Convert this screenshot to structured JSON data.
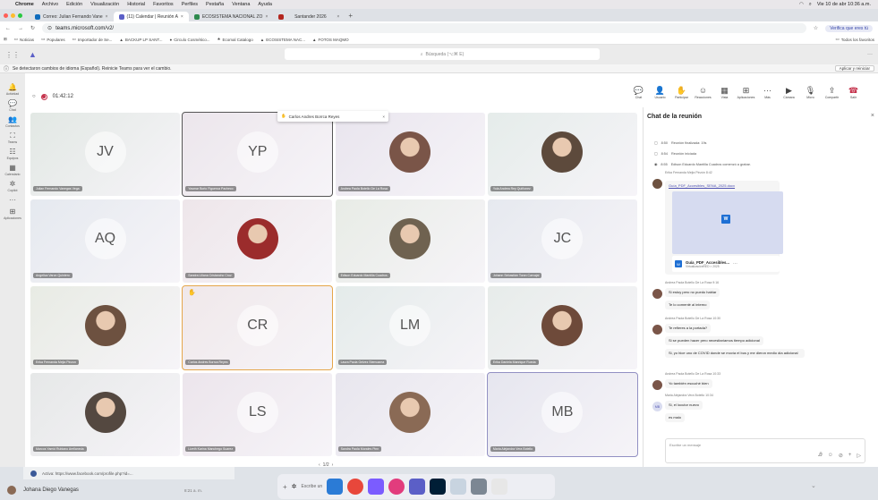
{
  "menubar": {
    "app": "Chrome",
    "items": [
      "Archivo",
      "Edición",
      "Visualización",
      "Historial",
      "Favoritos",
      "Perfiles",
      "Pestaña",
      "Ventana",
      "Ayuda"
    ],
    "clock": "Vie 10 de abr 10:36 a.m."
  },
  "tabs": [
    {
      "label": "Correo: Julian Fernando Vane",
      "color": "#0f6cbd"
    },
    {
      "label": "(11) Calendar | Reunión A",
      "color": "#5b5fc7"
    },
    {
      "label": "ECOSISTEMA NACIONAL ZO",
      "color": "#2d8a4e"
    },
    {
      "label": "Santander 2026",
      "color": "#b3261e"
    }
  ],
  "address": {
    "url": "teams.microsoft.com/v2/",
    "verify_label": "Verifica que eres tú"
  },
  "bookmarks": {
    "items": [
      "Noticias",
      "Populares",
      "Importador de Se...",
      "BACKUP LP SANT...",
      "Circulo Cosmético...",
      "Ecomal Catalogo",
      "ECOSISTEMA NAC...",
      "FOTOS MAQMO"
    ],
    "all": "Todos los favoritos"
  },
  "teams": {
    "search_placeholder": "Búsqueda (⌥⌘ E)",
    "notice": "Se detectaron cambios de idioma (Español). Reinicie Teams para ver el cambio.",
    "notice_button": "Aplicar y reiniciar"
  },
  "rail": [
    {
      "label": "Actividad",
      "icon": "bell-icon",
      "glyph": "🔔"
    },
    {
      "label": "Chat",
      "icon": "chat-icon",
      "glyph": "💬"
    },
    {
      "label": "Contactos",
      "icon": "people-icon",
      "glyph": "👥"
    },
    {
      "label": "Teams",
      "icon": "teams-icon",
      "glyph": "⛶"
    },
    {
      "label": "Equipos",
      "icon": "team-icon",
      "glyph": "☷"
    },
    {
      "label": "Calendario",
      "icon": "calendar-icon",
      "glyph": "▦"
    },
    {
      "label": "Copilot",
      "icon": "copilot-icon",
      "glyph": "✲"
    },
    {
      "label": "",
      "icon": "more-icon",
      "glyph": "···"
    },
    {
      "label": "Aplicaciones",
      "icon": "apps-icon",
      "glyph": "⊞"
    }
  ],
  "meeting": {
    "timer": "01:42:12",
    "toast": "Carlos Andres Borrca Reyes",
    "pager": "1/2",
    "tools": [
      {
        "label": "Chat",
        "glyph": "💬",
        "name": "chat"
      },
      {
        "label": "Usuario",
        "glyph": "👤",
        "name": "people"
      },
      {
        "label": "Participar",
        "glyph": "✋",
        "name": "raise"
      },
      {
        "label": "Reacciones",
        "glyph": "☺",
        "name": "react"
      },
      {
        "label": "Vista",
        "glyph": "▦",
        "name": "view"
      },
      {
        "label": "Aplicaciones",
        "glyph": "⊞",
        "name": "apps"
      },
      {
        "label": "Más",
        "glyph": "···",
        "name": "more"
      },
      {
        "label": "Cámara",
        "glyph": "▶",
        "name": "camera"
      },
      {
        "label": "Micro",
        "glyph": "🎙",
        "name": "mic"
      },
      {
        "label": "Compartir",
        "glyph": "⇪",
        "name": "share"
      },
      {
        "label": "Salir",
        "glyph": "☎",
        "name": "leave"
      }
    ]
  },
  "participants": [
    {
      "name": "Julian Fernando Vanegas Vega",
      "initials": "JV",
      "bg": "#e2e8e4"
    },
    {
      "name": "Yasmar Borio Figueroa Pacheco",
      "initials": "YP",
      "bg": "#ece6ec"
    },
    {
      "name": "Andrea Paola Botello De La Rosa",
      "photo": "#7a5548",
      "bg": "#e9e5ee"
    },
    {
      "name": "Yola Andrea Rey Quiñonez",
      "photo": "#5d4a3c",
      "bg": "#e5ecea"
    },
    {
      "name": "Angelica Varon Quintero",
      "initials": "AQ",
      "bg": "#e5e9ef"
    },
    {
      "name": "Sandra Liliana Cristancho Cruz",
      "photo": "#9b2c2c",
      "bg": "#eee6ea"
    },
    {
      "name": "Edison Eduardo Mantilla Cuadros",
      "photo": "#6f6250",
      "bg": "#e8ece6"
    },
    {
      "name": "Johann Sebastián Toran Carvajal",
      "initials": "JC",
      "bg": "#e6e9ef"
    },
    {
      "name": "Erika Fernanda Mejia Pinzon",
      "photo": "#6d5140",
      "bg": "#e8ebe4"
    },
    {
      "name": "Carlos Andres Borrca Reyes",
      "initials": "CR",
      "bg": "#f0e8ea"
    },
    {
      "name": "Laura Paola Gelvez Stemoama",
      "initials": "LM",
      "bg": "#e4ebea"
    },
    {
      "name": "Erika Daniela Manrique Rueda",
      "photo": "#6e4a3a",
      "bg": "#e7ecea"
    },
    {
      "name": "Marcos Yamid Rubiano Arellaneda",
      "photo": "#544840",
      "bg": "#e6e8e8"
    },
    {
      "name": "Lizeth Karina Manchego Suarez",
      "initials": "LS",
      "bg": "#ece5ec"
    },
    {
      "name": "Sandra Paola Morales Pinn",
      "photo": "#8a6a55",
      "bg": "#e8e6ee"
    },
    {
      "name": "Maria Alejandra Vera Botello",
      "initials": "MB",
      "bg": "#e6e6ef"
    }
  ],
  "chat": {
    "title": "Chat de la reunión",
    "events": [
      {
        "time": "8:50",
        "text": "Reunión finalizada: 19s"
      },
      {
        "time": "8:54",
        "text": "Reunión iniciada"
      },
      {
        "time": "8:55",
        "text": "Edison Eduardo Mantilla Cuadros comenzó a grabar."
      }
    ],
    "file_sender": "Erika Fernanda Mejia Pinzón 8:42",
    "file_link": "Guía_PDF_Accesibles_SENA_2025.docx",
    "file_name": "Guía_PDF_Accesibles...",
    "file_sub": "VirtualizaciónRED > 2025",
    "msgs": [
      {
        "sender": "Andrea Paola Botello De La Rosa 9:16",
        "lines": [
          "Si estoy pero no puedo hablar",
          "Te lo comenté al interno"
        ],
        "avatar": "#7a5548"
      },
      {
        "sender": "Andrea Paola Botello De La Rosa 10:30",
        "lines": [
          "Te refieres a la portada?",
          "Si se pueden hacer pero necesitaríamos tiempo adicional",
          "Si, yo hice uno de COVID donde se movía el bus y me dieron medio día adicional"
        ],
        "avatar": "#7a5548"
      },
      {
        "sender": "Andrea Paola Botello De La Rosa 10:33",
        "lines": [
          "Yo también escuché bien"
        ],
        "avatar": "#7a5548"
      },
      {
        "sender": "Maria Alejandra Vera Botello 10:34",
        "lines": [
          "Si, el locutor nuevo",
          "es malo"
        ],
        "avatar_initials": "MB"
      }
    ],
    "compose_placeholder": "Escribe un mensaje"
  },
  "taskbar": {
    "notif_url": "Activa: https://www.facebook.com/profile.php?id=...",
    "notif_name": "Johana Diego Vanegas",
    "notif_time": "8:21 a. m.",
    "write_label": "Escribe un"
  }
}
